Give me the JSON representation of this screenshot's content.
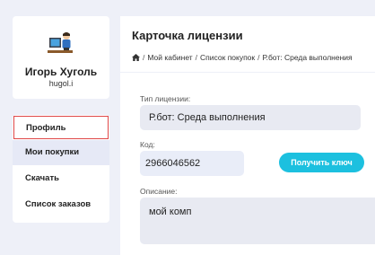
{
  "user": {
    "name": "Игорь Хуголь",
    "login": "hugol.i",
    "avatar_icon": "person-at-computer-icon"
  },
  "menu": {
    "items": [
      {
        "label": "Профиль",
        "active_outline": true
      },
      {
        "label": "Мои покупки",
        "selected": true
      },
      {
        "label": "Скачать"
      },
      {
        "label": "Список заказов"
      }
    ]
  },
  "page": {
    "title": "Карточка лицензии",
    "breadcrumb": {
      "home_icon": "home-icon",
      "items": [
        "Мой кабинет",
        "Список покупок",
        "Р.бот: Среда выполнения"
      ],
      "separator": "/"
    }
  },
  "form": {
    "license_type_label": "Тип лицензии:",
    "license_type_value": "Р.бот: Среда выполнения",
    "code_label": "Код:",
    "code_value": "2966046562",
    "get_key_label": "Получить ключ",
    "description_label": "Описание:",
    "description_value": "мой комп"
  },
  "colors": {
    "accent": "#1cc0df",
    "highlight_outline": "#e04848",
    "selected_menu_bg": "#e6e9f6",
    "page_bg": "#eef0f8"
  }
}
